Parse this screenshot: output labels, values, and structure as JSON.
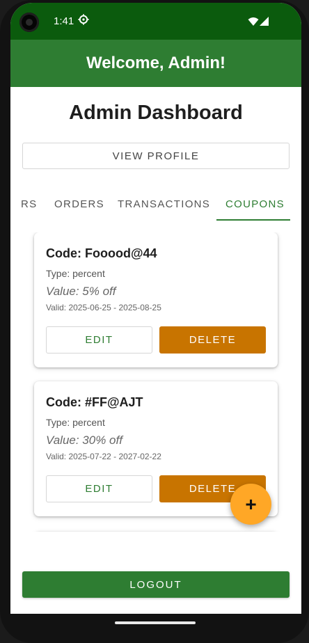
{
  "status_bar": {
    "time": "1:41",
    "settings_icon": "gear-icon",
    "wifi_icon": "wifi-icon",
    "signal_icon": "signal-icon"
  },
  "app_bar": {
    "title": "Welcome, Admin!",
    "color": "#2e7d32"
  },
  "page": {
    "title": "Admin Dashboard",
    "view_profile_label": "VIEW PROFILE"
  },
  "tabs": [
    {
      "label": "RS",
      "active": false
    },
    {
      "label": "ORDERS",
      "active": false
    },
    {
      "label": "TRANSACTIONS",
      "active": false
    },
    {
      "label": "COUPONS",
      "active": true
    }
  ],
  "coupons": [
    {
      "code": "Code: Fooood@44",
      "type": "Type: percent",
      "value": "Value: 5% off",
      "valid": "Valid: 2025-06-25 - 2025-08-25",
      "edit_label": "EDIT",
      "delete_label": "DELETE"
    },
    {
      "code": "Code: #FF@AJT",
      "type": "Type: percent",
      "value": "Value: 30% off",
      "valid": "Valid: 2025-07-22 - 2027-02-22",
      "edit_label": "EDIT",
      "delete_label": "DELETE"
    }
  ],
  "fab": {
    "icon": "plus-icon",
    "label": "+"
  },
  "logout_label": "LOGOUT",
  "colors": {
    "primary": "#2e7d32",
    "status_bar": "#0b5b0d",
    "delete": "#c87400",
    "fab": "#ffa726"
  }
}
